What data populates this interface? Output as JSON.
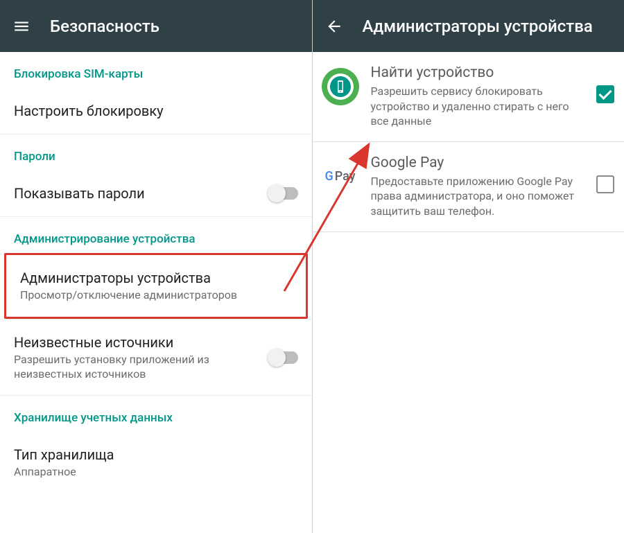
{
  "left": {
    "title": "Безопасность",
    "sections": {
      "sim": "Блокировка SIM-карты",
      "configure_lock": "Настроить блокировку",
      "passwords": "Пароли",
      "show_passwords": "Показывать пароли",
      "device_admin": "Администрирование устройства",
      "admins_title": "Администраторы устройства",
      "admins_sub": "Просмотр/отключение администраторов",
      "unknown_title": "Неизвестные источники",
      "unknown_sub": "Разрешить установку приложений из неизвестных источников",
      "creds": "Хранилище учетных данных",
      "storage_title": "Тип хранилища",
      "storage_sub": "Аппаратное"
    }
  },
  "right": {
    "title": "Администраторы устройства",
    "items": [
      {
        "title": "Найти устройство",
        "sub": "Разрешить сервису блокировать устройство и удаленно стирать с него все данные",
        "checked": true
      },
      {
        "title": "Google Pay",
        "sub": "Предоставьте приложению Google Pay права администратора, и оно поможет защитить ваш телефон.",
        "checked": false
      }
    ]
  },
  "colors": {
    "teal": "#009688",
    "appbar": "#2f4047",
    "highlight": "#d9362e"
  }
}
